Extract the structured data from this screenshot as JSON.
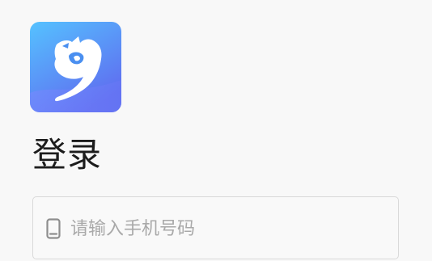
{
  "app": {
    "logo_icon": "app-logo-icon"
  },
  "login": {
    "title": "登录",
    "phone_placeholder": "请输入手机号码",
    "phone_value": "",
    "phone_icon": "mobile-phone-icon"
  },
  "colors": {
    "logo_gradient_top": "#55c2ff",
    "logo_gradient_bottom": "#5f6df0",
    "field_border": "#d9d9d9",
    "placeholder": "#a9a9a9",
    "title_text": "#1c1c1c"
  }
}
